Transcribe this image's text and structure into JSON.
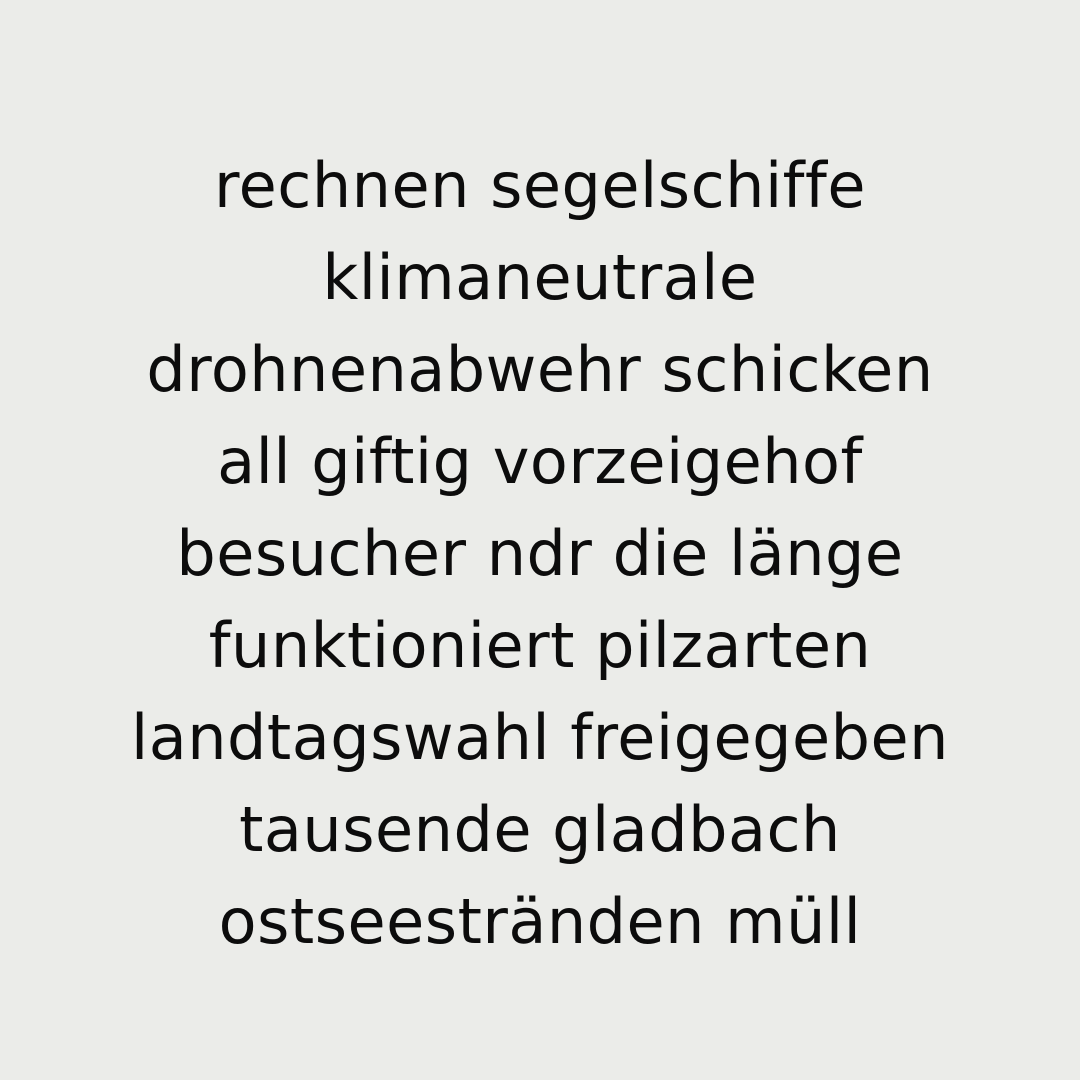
{
  "colors": {
    "background": "#ebece9",
    "text": "#0c0c0c"
  },
  "lines": [
    "rechnen segelschiffe",
    "klimaneutrale",
    "drohnenabwehr schicken",
    "all giftig vorzeigehof",
    "besucher ndr die länge",
    "funktioniert pilzarten",
    "landtagswahl freigegeben",
    "tausende gladbach",
    "ostseestränden müll"
  ]
}
